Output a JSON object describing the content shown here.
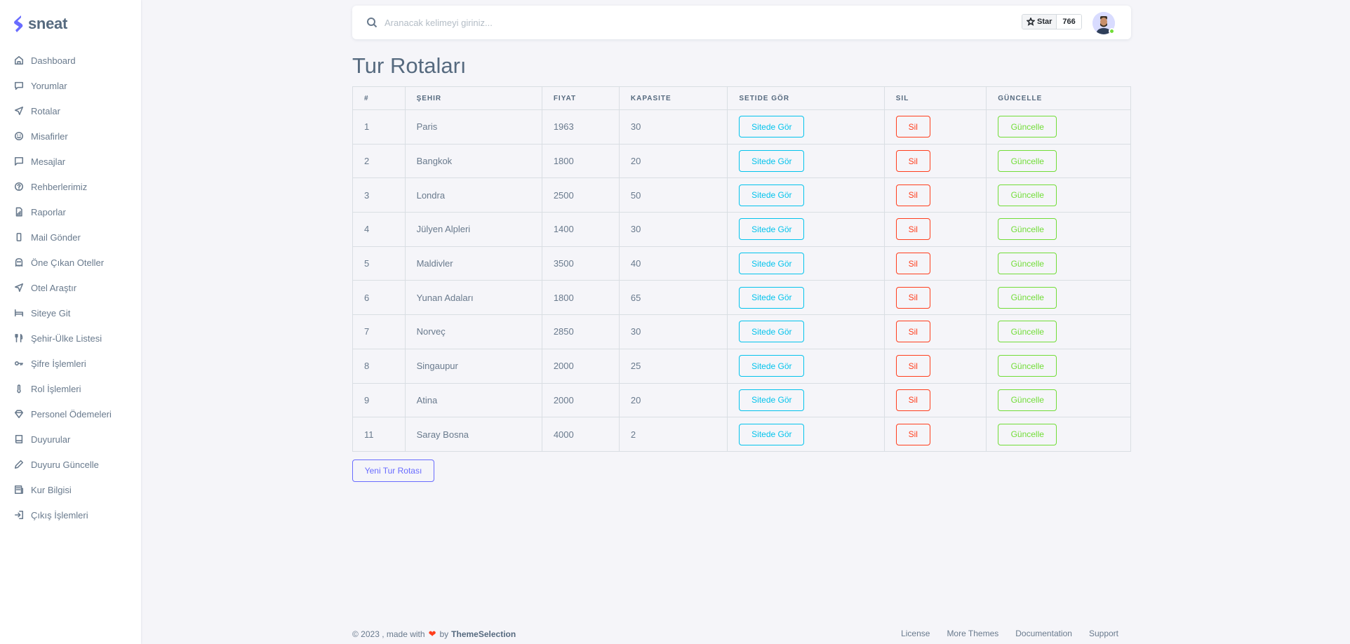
{
  "brand": {
    "name": "sneat",
    "accent": "#696cff"
  },
  "sidebar": {
    "items": [
      {
        "label": "Dashboard",
        "icon": "home-icon"
      },
      {
        "label": "Yorumlar",
        "icon": "comment-icon"
      },
      {
        "label": "Rotalar",
        "icon": "plane-icon"
      },
      {
        "label": "Misafirler",
        "icon": "smile-icon"
      },
      {
        "label": "Mesajlar",
        "icon": "message-icon"
      },
      {
        "label": "Rehberlerimiz",
        "icon": "help-circle-icon"
      },
      {
        "label": "Raporlar",
        "icon": "report-file-icon"
      },
      {
        "label": "Mail Gönder",
        "icon": "mobile-icon"
      },
      {
        "label": "Öne Çıkan Oteller",
        "icon": "ghost-icon"
      },
      {
        "label": "Otel Araştır",
        "icon": "send-icon"
      },
      {
        "label": "Siteye Git",
        "icon": "bed-icon"
      },
      {
        "label": "Şehir-Ülke Listesi",
        "icon": "restaurant-icon"
      },
      {
        "label": "Şifre İşlemleri",
        "icon": "key-icon"
      },
      {
        "label": "Rol İşlemleri",
        "icon": "thermometer-icon"
      },
      {
        "label": "Personel Ödemeleri",
        "icon": "diamond-icon"
      },
      {
        "label": "Duyurular",
        "icon": "book-icon"
      },
      {
        "label": "Duyuru Güncelle",
        "icon": "pen-icon"
      },
      {
        "label": "Kur Bilgisi",
        "icon": "news-icon"
      },
      {
        "label": "Çıkış İşlemleri",
        "icon": "log-in-icon"
      }
    ]
  },
  "header": {
    "search_placeholder": "Aranacak kelimeyi giriniz...",
    "github_star_label": "Star",
    "github_star_count": "766"
  },
  "page": {
    "title": "Tur Rotaları"
  },
  "table": {
    "columns": [
      "#",
      "ŞEHIR",
      "FIYAT",
      "KAPASITE",
      "SETIDE GÖR",
      "SIL",
      "GÜNCELLE"
    ],
    "view_label": "Sitede Gör",
    "delete_label": "Sil",
    "update_label": "Güncelle",
    "rows": [
      {
        "id": "1",
        "city": "Paris",
        "price": "1963",
        "capacity": "30"
      },
      {
        "id": "2",
        "city": "Bangkok",
        "price": "1800",
        "capacity": "20"
      },
      {
        "id": "3",
        "city": "Londra",
        "price": "2500",
        "capacity": "50"
      },
      {
        "id": "4",
        "city": "Jülyen Alpleri",
        "price": "1400",
        "capacity": "30"
      },
      {
        "id": "5",
        "city": "Maldivler",
        "price": "3500",
        "capacity": "40"
      },
      {
        "id": "6",
        "city": "Yunan Adaları",
        "price": "1800",
        "capacity": "65"
      },
      {
        "id": "7",
        "city": "Norveç",
        "price": "2850",
        "capacity": "30"
      },
      {
        "id": "8",
        "city": "Singaupur",
        "price": "2000",
        "capacity": "25"
      },
      {
        "id": "9",
        "city": "Atina",
        "price": "2000",
        "capacity": "20"
      },
      {
        "id": "11",
        "city": "Saray Bosna",
        "price": "4000",
        "capacity": "2"
      }
    ]
  },
  "actions": {
    "new_route_label": "Yeni Tur Rotası"
  },
  "footer": {
    "copyright": "© 2023 , made with",
    "by": "by",
    "brand": "ThemeSelection",
    "links": [
      "License",
      "More Themes",
      "Documentation",
      "Support"
    ]
  }
}
